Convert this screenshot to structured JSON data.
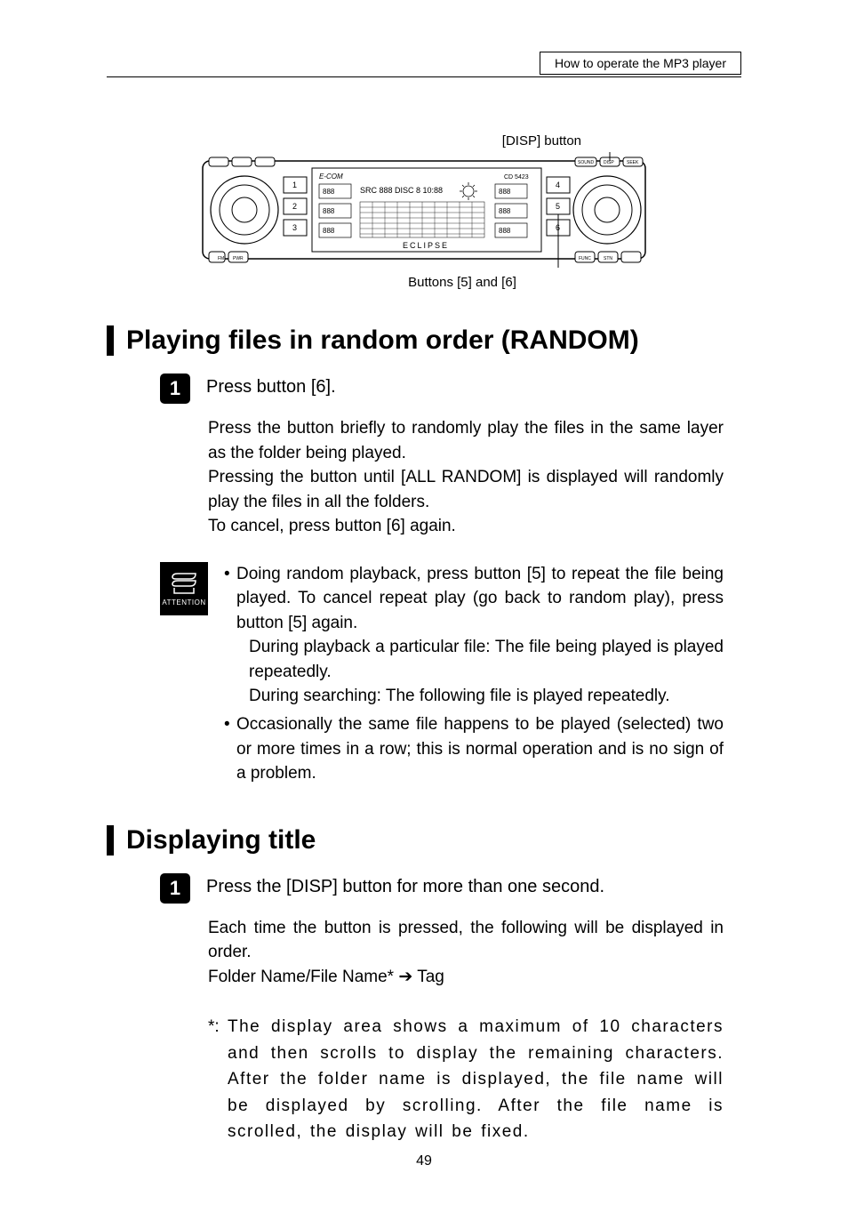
{
  "header": {
    "breadcrumb": "How to operate the MP3 player"
  },
  "figure": {
    "disp_label": "[DISP] button",
    "buttons_label": "Buttons [5] and [6]",
    "brand": "ECLIPSE",
    "model_left": "E-COM",
    "model_right": "CD 5423"
  },
  "section1": {
    "title": "Playing files in random order (RANDOM)",
    "step_num": "1",
    "step_title": "Press button [6].",
    "body1": "Press the button briefly to randomly play the files in the same layer as the folder being played.",
    "body2": "Pressing the button until [ALL RANDOM] is displayed will randomly play the files in all the folders.",
    "body3": "To cancel, press button [6] again.",
    "attention_label": "ATTENTION",
    "att_b1": "Doing random playback, press button [5] to repeat the file being played. To cancel repeat play (go back to random play), press button [5] again.",
    "att_b1_sub1": "During playback a particular file: The file being played is played repeatedly.",
    "att_b1_sub2": "During searching: The following file is played repeatedly.",
    "att_b2": "Occasionally the same file happens to be played (selected) two or more times in a row; this is normal operation and is no sign of a problem."
  },
  "section2": {
    "title": "Displaying title",
    "step_num": "1",
    "step_title": "Press the [DISP] button for more than one second.",
    "body1": "Each time the button is pressed, the following will be displayed in order.",
    "body2_pre": "Folder Name/File Name* ",
    "body2_post": " Tag",
    "footnote_marker": "*:",
    "footnote": "The display area shows a maximum of 10 characters and then scrolls to display the remaining characters. After the folder name is displayed, the file name will be displayed by scrolling. After the file name is scrolled, the display will be fixed."
  },
  "page_number": "49"
}
